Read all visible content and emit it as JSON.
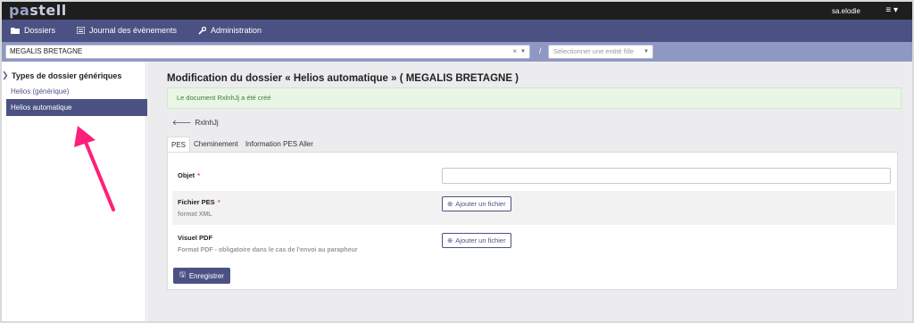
{
  "app": {
    "logo_pa": "pa",
    "logo_rest": "stell",
    "user": "sa.elodie"
  },
  "nav": {
    "items": [
      "Dossiers",
      "Journal des évènements",
      "Administration"
    ]
  },
  "entity_bar": {
    "entity": "MEGALIS BRETAGNE",
    "file_placeholder": "Sélectionner une entité fille",
    "separator": "/"
  },
  "sidebar": {
    "title": "Types de dossier génériques",
    "items": [
      {
        "label": "Helios (générique)"
      },
      {
        "label": "Helios automatique"
      }
    ]
  },
  "main": {
    "title": "Modification du dossier « Helios automatique » ( MEGALIS BRETAGNE )",
    "alert": "Le document RxlnhJj a été créé",
    "back_label": "RxlnhJj",
    "tabs": [
      "PES",
      "Cheminement",
      "Information PES Aller"
    ],
    "fields": {
      "objet_label": "Objet",
      "objet_value": "",
      "fichier_pes_label": "Fichier PES",
      "fichier_pes_hint": "format XML",
      "visuel_pdf_label": "Visuel PDF",
      "visuel_pdf_hint": "Format PDF - obligatoire dans le cas de l'envoi au parapheur",
      "add_file_label": "Ajouter un fichier",
      "required_mark": "*"
    },
    "save_label": "Enregistrer"
  },
  "colors": {
    "primary": "#4b5283",
    "entity_bar": "#8f97c3",
    "top_bar": "#1e1e1e",
    "annotation": "#ff1f7a"
  }
}
